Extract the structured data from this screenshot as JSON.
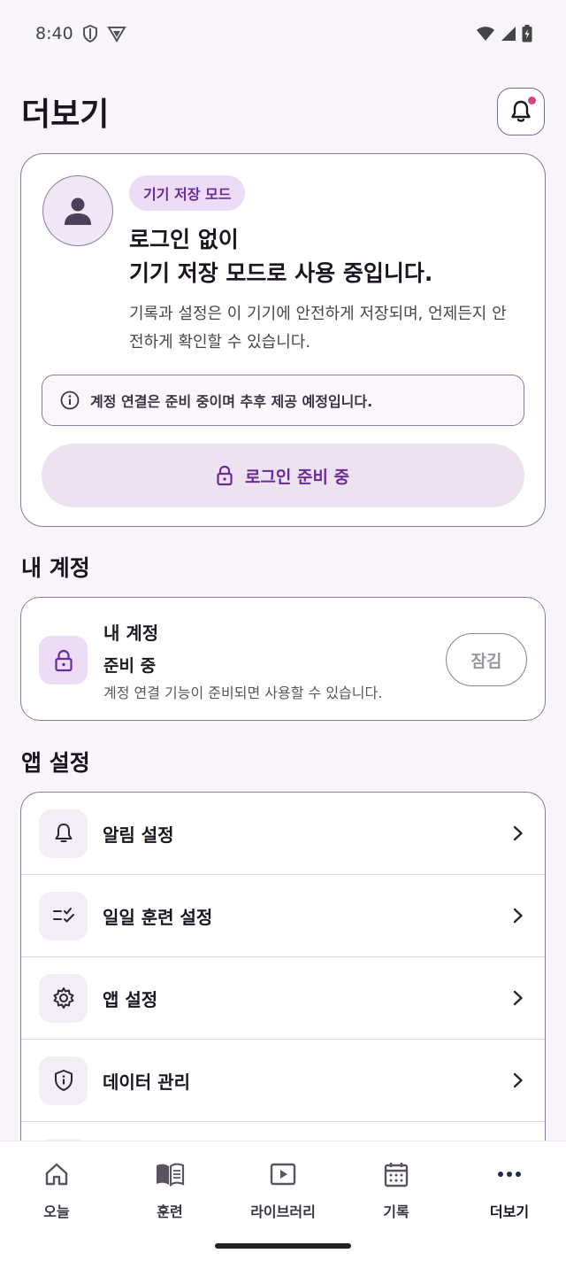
{
  "status_bar": {
    "time": "8:40",
    "icons_left": [
      "shield-icon",
      "vpn-icon"
    ],
    "icons_right": [
      "wifi-icon",
      "signal-icon",
      "battery-icon"
    ]
  },
  "header": {
    "title": "더보기",
    "notification_icon": "bell-icon",
    "has_unread": true
  },
  "storage_card": {
    "badge": "기기 저장 모드",
    "headline_line1": "로그인 없이",
    "headline_line2": "기기 저장 모드로 사용 중입니다.",
    "description": "기록과 설정은 이 기기에 안전하게 저장되며, 언제든지 안전하게 확인할 수 있습니다.",
    "notice": "계정 연결은 준비 중이며 추후 제공 예정입니다.",
    "login_button": "로그인 준비 중"
  },
  "account_section": {
    "title": "내 계정",
    "card_title": "내 계정",
    "status": "준비 중",
    "description": "계정 연결 기능이 준비되면 사용할 수 있습니다.",
    "lock_label": "잠김"
  },
  "settings_section": {
    "title": "앱 설정",
    "items": [
      {
        "label": "알림 설정",
        "icon": "bell-icon"
      },
      {
        "label": "일일 훈련 설정",
        "icon": "checklist-icon"
      },
      {
        "label": "앱 설정",
        "icon": "gear-icon"
      },
      {
        "label": "데이터 관리",
        "icon": "shield-info-icon"
      }
    ]
  },
  "bottom_nav": {
    "items": [
      {
        "label": "오늘",
        "icon": "home-icon"
      },
      {
        "label": "훈련",
        "icon": "book-icon"
      },
      {
        "label": "라이브러리",
        "icon": "play-icon"
      },
      {
        "label": "기록",
        "icon": "calendar-icon"
      },
      {
        "label": "더보기",
        "icon": "more-icon"
      }
    ],
    "active": "더보기"
  },
  "colors": {
    "accent": "#6a2a9a",
    "badge_bg": "#ecdcf6",
    "border": "#8b7a9e",
    "notification_dot": "#e0407a",
    "background": "#f8f5fa"
  }
}
